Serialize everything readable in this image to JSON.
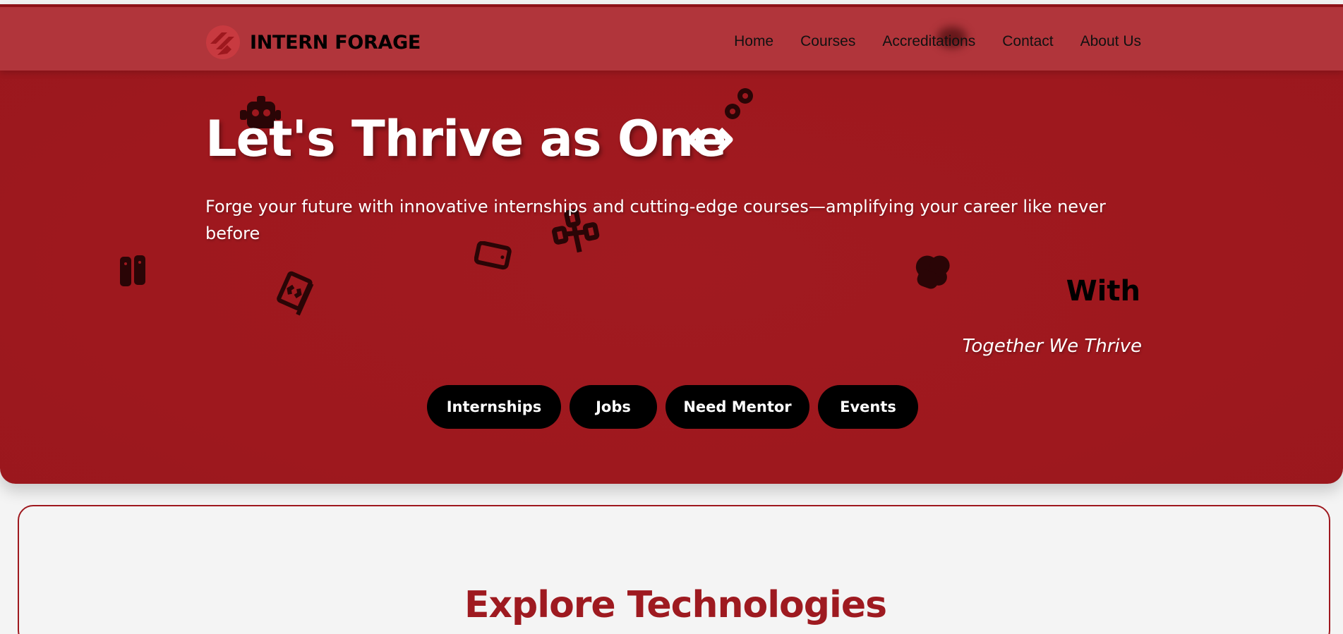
{
  "brand": {
    "name": "INTERN FORAGE",
    "accent": "#9e181e",
    "nav_color": "#b1353b"
  },
  "nav": {
    "items": [
      "Home",
      "Courses",
      "Accreditations",
      "Contact",
      "About Us"
    ]
  },
  "hero": {
    "title": "Let's Thrive as One",
    "subtitle": "Forge your future with innovative internships and cutting-edge courses—amplifying your career like never before",
    "with_text": "With",
    "tagline": "Together We Thrive",
    "buttons": [
      "Internships",
      "Jobs",
      "Need Mentor",
      "Events"
    ],
    "decor_icons": [
      "robot-icon",
      "gears-icon",
      "code-brackets-icon",
      "sitemap-icon",
      "mobile-icon",
      "sim-card-icon",
      "book-code-icon",
      "cloud-icon"
    ]
  },
  "section": {
    "title": "Explore Technologies"
  }
}
